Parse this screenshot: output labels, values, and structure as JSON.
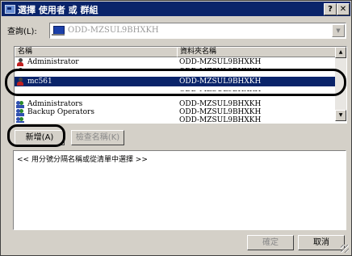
{
  "window": {
    "title": "選擇 使用者 或 群組",
    "help": "?",
    "close": "✕"
  },
  "look_in": {
    "label": "查詢(L):",
    "value": "ODD-MZSUL9BHXKH"
  },
  "list": {
    "columns": [
      "名稱",
      "資料夾名稱"
    ],
    "rows": [
      {
        "name": "Administrator",
        "folder": "ODD-MZSUL9BHXKH",
        "icon": "user-icon",
        "selected": false
      },
      {
        "name": "",
        "folder": "ODD-MZSUL9BHXKH",
        "icon": "user-icon",
        "selected": false
      },
      {
        "name": "mc561",
        "folder": "ODD-MZSUL9BHXKH",
        "icon": "user-icon",
        "selected": true
      },
      {
        "name": "",
        "folder": "ODD-MZSUL9BHXKH",
        "icon": "",
        "selected": false
      },
      {
        "name": "",
        "folder": "",
        "icon": "",
        "selected": false
      },
      {
        "name": "Administrators",
        "folder": "ODD-MZSUL9BHXKH",
        "icon": "group-icon",
        "selected": false
      },
      {
        "name": "Backup Operators",
        "folder": "ODD-MZSUL9BHXKH",
        "icon": "group-icon",
        "selected": false
      },
      {
        "name": "",
        "folder": "ODD-MZSUL9BHXKH",
        "icon": "group-icon",
        "selected": false
      }
    ]
  },
  "buttons": {
    "add": "新增(A)",
    "check_names": "檢查名稱(K)",
    "ok": "確定",
    "cancel": "取消"
  },
  "hint": "<< 用分號分隔名稱或從清單中選擇 >>",
  "colors": {
    "titlebar": "#0a246a",
    "selection": "#0a246a",
    "face": "#d4d0c8"
  }
}
